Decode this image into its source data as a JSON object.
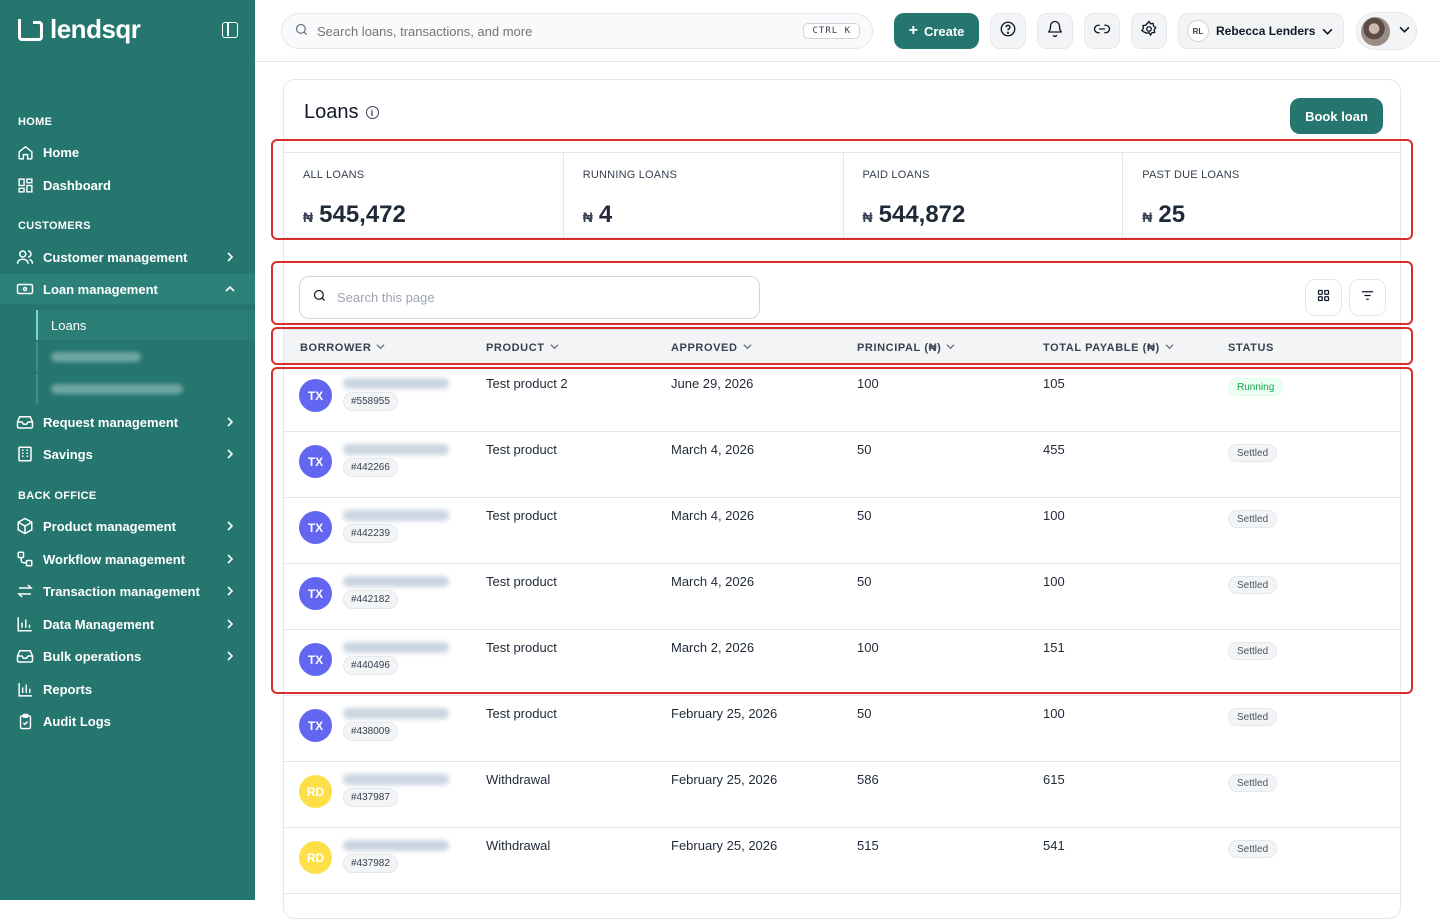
{
  "brand": {
    "name": "lendsqr"
  },
  "sidebar": {
    "sections": {
      "home": "HOME",
      "customers": "CUSTOMERS",
      "back_office": "BACK OFFICE"
    },
    "items": {
      "home": "Home",
      "dashboard": "Dashboard",
      "customer_management": "Customer management",
      "loan_management": "Loan management",
      "loans": "Loans",
      "request_management": "Request management",
      "savings": "Savings",
      "product_management": "Product management",
      "workflow_management": "Workflow management",
      "transaction_management": "Transaction management",
      "data_management": "Data Management",
      "bulk_operations": "Bulk operations",
      "reports": "Reports",
      "audit_logs": "Audit Logs"
    }
  },
  "topbar": {
    "search_placeholder": "Search loans, transactions, and more",
    "shortcut": "CTRL K",
    "create_label": "Create",
    "user_initials": "RL",
    "user_name": "Rebecca Lenders"
  },
  "page": {
    "title": "Loans",
    "book_loan": "Book loan",
    "stats": [
      {
        "label": "ALL LOANS",
        "currency": "₦",
        "value": "545,472"
      },
      {
        "label": "RUNNING LOANS",
        "currency": "₦",
        "value": "4"
      },
      {
        "label": "PAID LOANS",
        "currency": "₦",
        "value": "544,872"
      },
      {
        "label": "PAST DUE LOANS",
        "currency": "₦",
        "value": "25"
      }
    ],
    "search_placeholder": "Search this page"
  },
  "table": {
    "headers": {
      "borrower": "BORROWER",
      "product": "PRODUCT",
      "approved": "APPROVED",
      "principal": "PRINCIPAL (₦)",
      "total_payable": "TOTAL PAYABLE (₦)",
      "status": "STATUS"
    },
    "rows": [
      {
        "initials": "TX",
        "id": "#558955",
        "product": "Test product 2",
        "approved": "June 29, 2026",
        "principal": "100",
        "total": "105",
        "status": "Running"
      },
      {
        "initials": "TX",
        "id": "#442266",
        "product": "Test product",
        "approved": "March 4, 2026",
        "principal": "50",
        "total": "455",
        "status": "Settled"
      },
      {
        "initials": "TX",
        "id": "#442239",
        "product": "Test product",
        "approved": "March 4, 2026",
        "principal": "50",
        "total": "100",
        "status": "Settled"
      },
      {
        "initials": "TX",
        "id": "#442182",
        "product": "Test product",
        "approved": "March 4, 2026",
        "principal": "50",
        "total": "100",
        "status": "Settled"
      },
      {
        "initials": "TX",
        "id": "#440496",
        "product": "Test product",
        "approved": "March 2, 2026",
        "principal": "100",
        "total": "151",
        "status": "Settled"
      },
      {
        "initials": "TX",
        "id": "#438009",
        "product": "Test product",
        "approved": "February 25, 2026",
        "principal": "50",
        "total": "100",
        "status": "Settled"
      },
      {
        "initials": "RD",
        "id": "#437987",
        "product": "Withdrawal",
        "approved": "February 25, 2026",
        "principal": "586",
        "total": "615",
        "status": "Settled"
      },
      {
        "initials": "RD",
        "id": "#437982",
        "product": "Withdrawal",
        "approved": "February 25, 2026",
        "principal": "515",
        "total": "541",
        "status": "Settled"
      }
    ]
  },
  "colors": {
    "sidebar_bg": "#24766f",
    "accent": "#24766f",
    "avatar_tx": "#6366f1",
    "avatar_rd": "#fde047",
    "highlight": "#d92d2d"
  }
}
